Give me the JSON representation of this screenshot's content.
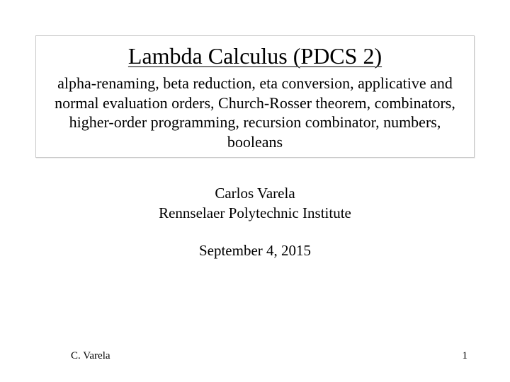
{
  "header": {
    "title": "Lambda Calculus (PDCS 2)",
    "subtitle": "alpha-renaming, beta reduction, eta conversion, applicative and normal evaluation orders, Church-Rosser theorem, combinators, higher-order programming, recursion combinator, numbers, booleans"
  },
  "author": {
    "name": "Carlos Varela",
    "affiliation": "Rennselaer Polytechnic Institute"
  },
  "date": "September 4, 2015",
  "footer": {
    "left": "C. Varela",
    "page": "1"
  }
}
